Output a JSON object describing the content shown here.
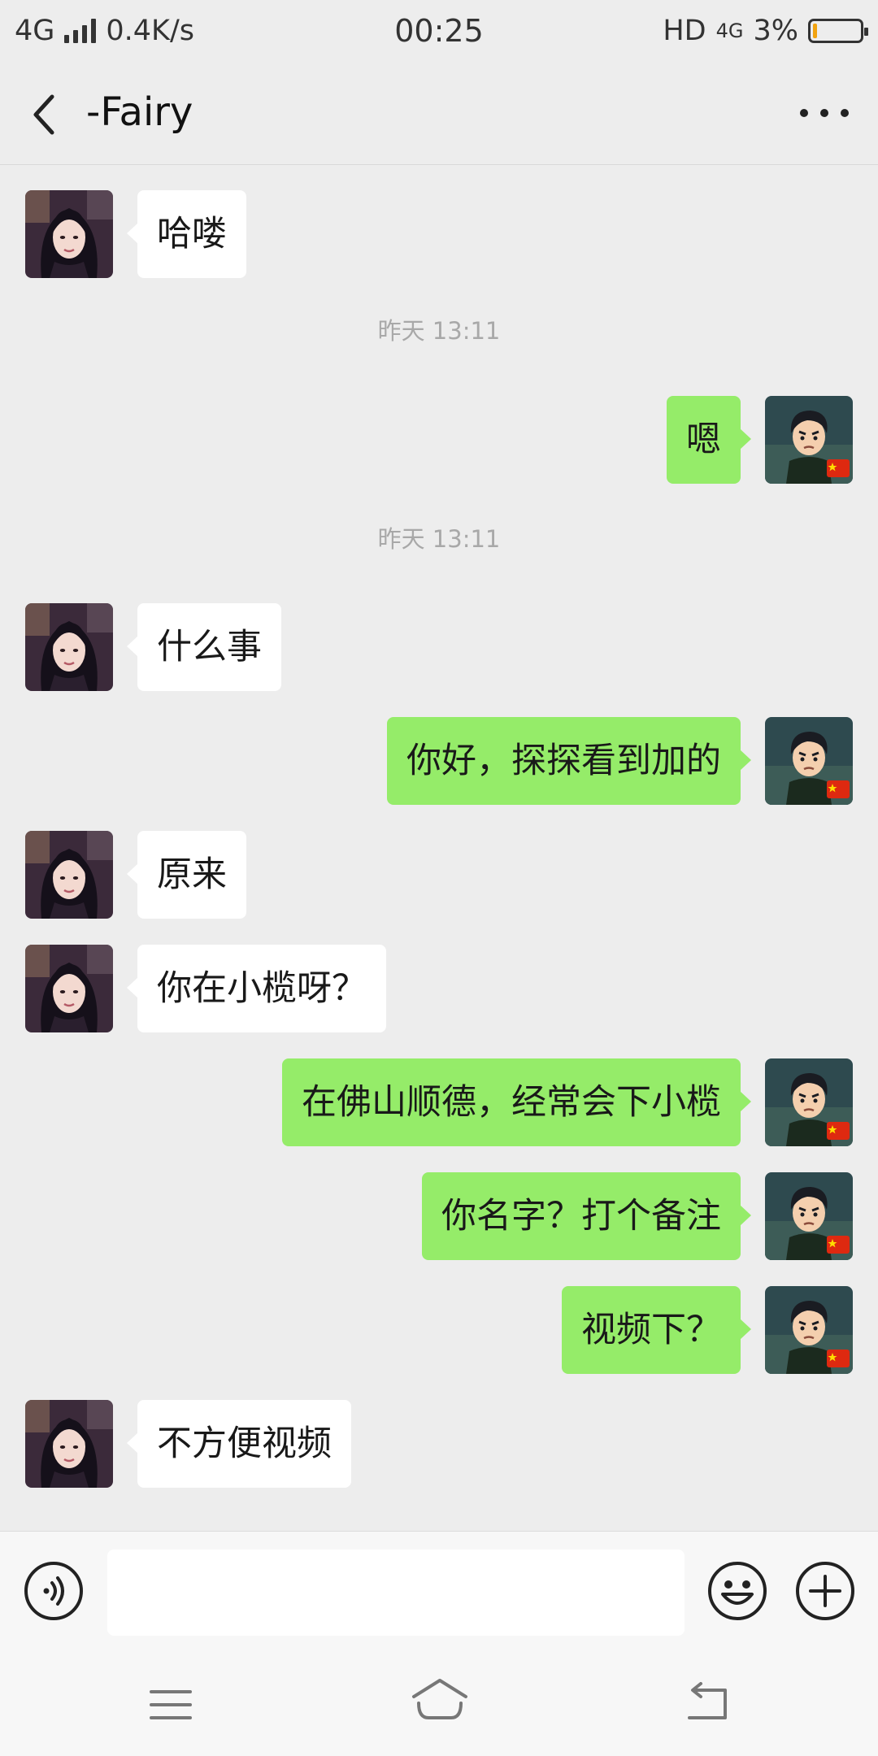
{
  "status_bar": {
    "network": "4G",
    "speed": "0.4K/s",
    "time": "00:25",
    "hd": "HD",
    "network_right": "4G",
    "battery": "3%",
    "battery_level": 0.03
  },
  "header": {
    "title": "-Fairy",
    "back_icon": "chevron-left-icon",
    "more_icon": "more-dots-icon"
  },
  "messages": [
    {
      "kind": "msg",
      "side": "left",
      "text": "哈喽",
      "avatar": "contact-avatar"
    },
    {
      "kind": "time",
      "text": "昨天 13:11"
    },
    {
      "kind": "msg",
      "side": "right",
      "text": "嗯",
      "avatar": "self-avatar"
    },
    {
      "kind": "time",
      "text": "昨天 13:11"
    },
    {
      "kind": "msg",
      "side": "left",
      "text": "什么事",
      "avatar": "contact-avatar"
    },
    {
      "kind": "msg",
      "side": "right",
      "text": "你好，探探看到加的",
      "avatar": "self-avatar"
    },
    {
      "kind": "msg",
      "side": "left",
      "text": "原来",
      "avatar": "contact-avatar"
    },
    {
      "kind": "msg",
      "side": "left",
      "text": "你在小榄呀？",
      "avatar": "contact-avatar"
    },
    {
      "kind": "msg",
      "side": "right",
      "text": "在佛山顺德，经常会下小榄",
      "avatar": "self-avatar"
    },
    {
      "kind": "msg",
      "side": "right",
      "text": "你名字？打个备注",
      "avatar": "self-avatar"
    },
    {
      "kind": "msg",
      "side": "right",
      "text": "视频下？",
      "avatar": "self-avatar"
    },
    {
      "kind": "msg",
      "side": "left",
      "text": "不方便视频",
      "avatar": "contact-avatar"
    }
  ],
  "input_bar": {
    "voice_icon": "voice-icon",
    "emoji_icon": "emoji-icon",
    "plus_icon": "plus-icon",
    "input_value": ""
  },
  "nav_bar": {
    "menu_icon": "menu-icon",
    "home_icon": "home-icon",
    "back_icon": "back-icon"
  },
  "colors": {
    "background": "#ededed",
    "bubble_self": "#95ec69",
    "bubble_other": "#ffffff",
    "timestamp": "#a8a8a8"
  }
}
